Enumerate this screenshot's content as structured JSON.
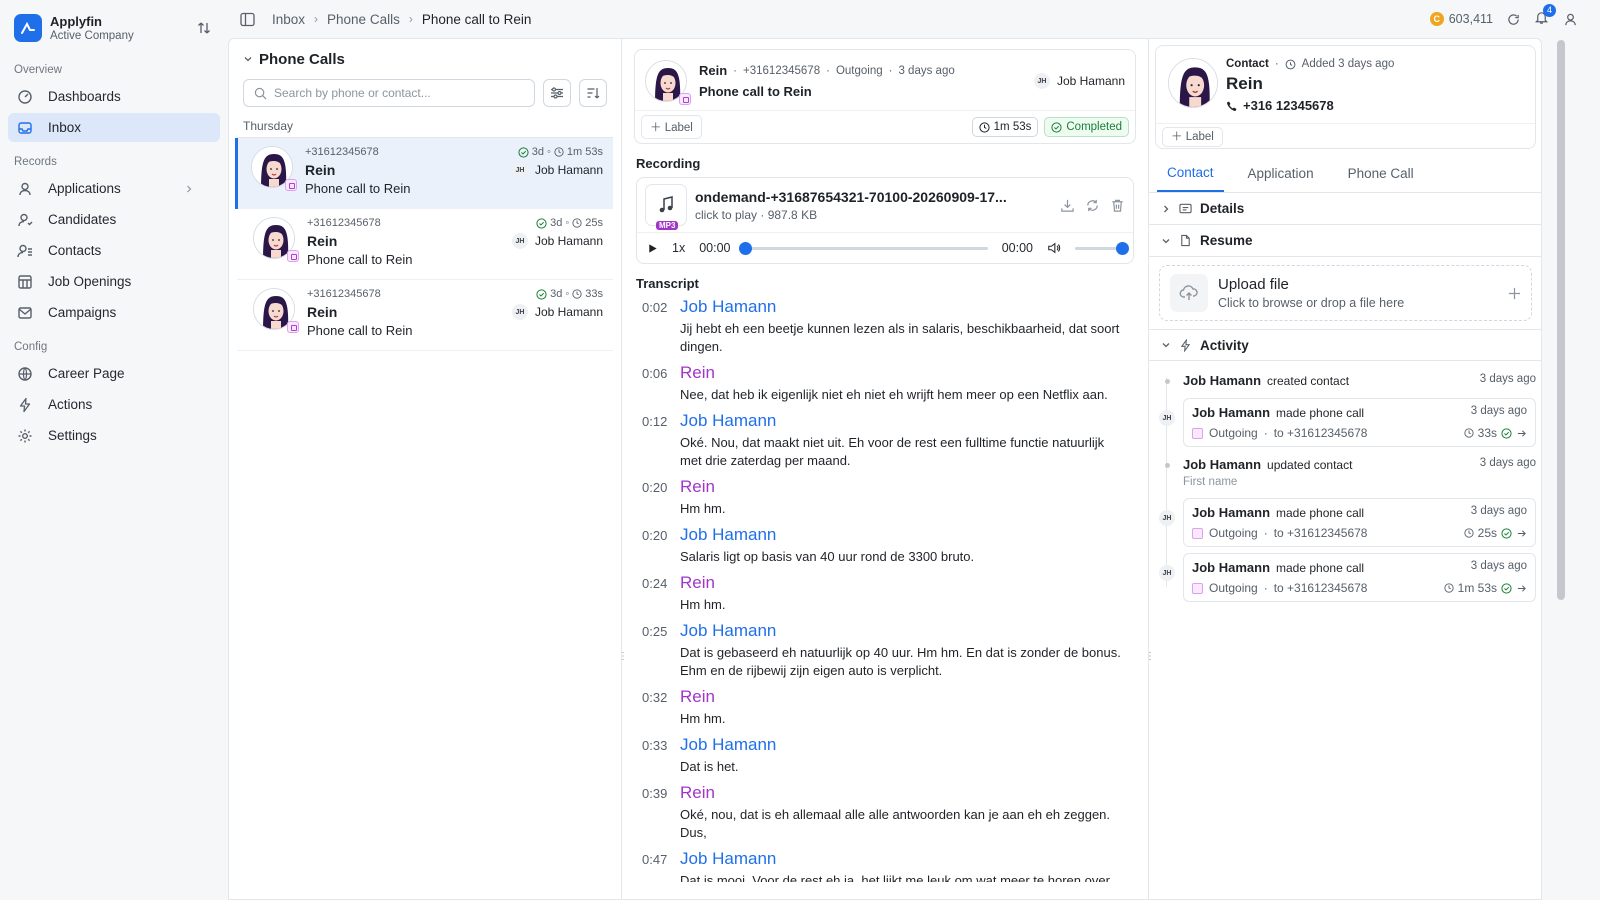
{
  "app": {
    "name": "Applyfin",
    "company": "Active Company"
  },
  "sidebar": {
    "sections": [
      {
        "title": "Overview",
        "items": [
          {
            "label": "Dashboards",
            "icon": "dashboard-icon"
          },
          {
            "label": "Inbox",
            "icon": "inbox-icon",
            "active": true
          }
        ]
      },
      {
        "title": "Records",
        "items": [
          {
            "label": "Applications",
            "icon": "applications-icon"
          },
          {
            "label": "Candidates",
            "icon": "candidates-icon"
          },
          {
            "label": "Contacts",
            "icon": "contacts-icon"
          },
          {
            "label": "Job Openings",
            "icon": "job-openings-icon"
          },
          {
            "label": "Campaigns",
            "icon": "campaigns-icon"
          }
        ]
      },
      {
        "title": "Config",
        "items": [
          {
            "label": "Career Page",
            "icon": "globe-icon"
          },
          {
            "label": "Actions",
            "icon": "bolt-icon"
          },
          {
            "label": "Settings",
            "icon": "gear-icon"
          }
        ]
      }
    ]
  },
  "topbar": {
    "breadcrumbs": [
      "Inbox",
      "Phone Calls",
      "Phone call to Rein"
    ],
    "credits": "603,411",
    "notifications": "4"
  },
  "list": {
    "title": "Phone Calls",
    "search_placeholder": "Search by phone or contact...",
    "group": "Thursday",
    "calls": [
      {
        "phone": "+31612345678",
        "age": "3d",
        "duration": "1m 53s",
        "name": "Rein",
        "subject": "Phone call to Rein",
        "owner_initials": "JH",
        "owner": "Job Hamann"
      },
      {
        "phone": "+31612345678",
        "age": "3d",
        "duration": "25s",
        "name": "Rein",
        "subject": "Phone call to Rein",
        "owner_initials": "JH",
        "owner": "Job Hamann"
      },
      {
        "phone": "+31612345678",
        "age": "3d",
        "duration": "33s",
        "name": "Rein",
        "subject": "Phone call to Rein",
        "owner_initials": "JH",
        "owner": "Job Hamann"
      }
    ]
  },
  "call": {
    "contact": "Rein",
    "phone": "+31612345678",
    "direction": "Outgoing",
    "when": "3 days ago",
    "title": "Phone call to Rein",
    "owner_initials": "JH",
    "owner": "Job Hamann",
    "label_btn": "Label",
    "duration": "1m 53s",
    "status": "Completed"
  },
  "recording": {
    "heading": "Recording",
    "file_name": "ondemand-+31687654321-70100-20260909-17...",
    "hint": "click to play",
    "size": "987.8 KB",
    "format": "MP3",
    "speed": "1x",
    "current": "00:00",
    "total": "00:00"
  },
  "transcript": {
    "heading": "Transcript",
    "entries": [
      {
        "time": "0:02",
        "speaker": "Job Hamann",
        "role": "job",
        "text": "Jij hebt eh een beetje kunnen lezen als in salaris, beschikbaarheid, dat soort dingen."
      },
      {
        "time": "0:06",
        "speaker": "Rein",
        "role": "rein",
        "text": "Nee, dat heb ik eigenlijk niet eh niet eh wrijft hem meer op een Netflix aan."
      },
      {
        "time": "0:12",
        "speaker": "Job Hamann",
        "role": "job",
        "text": "Oké. Nou, dat maakt niet uit. Eh voor de rest een fulltime functie natuurlijk met drie zaterdag per maand."
      },
      {
        "time": "0:20",
        "speaker": "Rein",
        "role": "rein",
        "text": "Hm hm."
      },
      {
        "time": "0:20",
        "speaker": "Job Hamann",
        "role": "job",
        "text": "Salaris ligt op basis van 40 uur rond de 3300 bruto."
      },
      {
        "time": "0:24",
        "speaker": "Rein",
        "role": "rein",
        "text": "Hm hm."
      },
      {
        "time": "0:25",
        "speaker": "Job Hamann",
        "role": "job",
        "text": "Dat is gebaseerd eh natuurlijk op 40 uur. Hm hm. En dat is zonder de bonus. Ehm en de rijbewij zijn eigen auto is verplicht."
      },
      {
        "time": "0:32",
        "speaker": "Rein",
        "role": "rein",
        "text": "Hm hm."
      },
      {
        "time": "0:33",
        "speaker": "Job Hamann",
        "role": "job",
        "text": "Dat is het."
      },
      {
        "time": "0:39",
        "speaker": "Rein",
        "role": "rein",
        "text": "Oké, nou, dat is eh allemaal alle alle antwoorden kan je aan eh eh zeggen. Dus,"
      },
      {
        "time": "0:47",
        "speaker": "Job Hamann",
        "role": "job",
        "text": "Dat is mooi. Voor de rest eh ja, het lijkt me leuk om wat meer te horen over"
      }
    ]
  },
  "contact": {
    "kind": "Contact",
    "added": "Added 3 days ago",
    "name": "Rein",
    "phone": "+316 12345678",
    "label_btn": "Label",
    "tabs": [
      "Contact",
      "Application",
      "Phone Call"
    ],
    "sections": {
      "details": "Details",
      "resume": "Resume",
      "activity": "Activity"
    },
    "upload": {
      "title": "Upload file",
      "subtitle": "Click to browse or drop a file here"
    },
    "activity": [
      {
        "type": "simple",
        "who": "Job Hamann",
        "action": "created contact",
        "when": "3 days ago"
      },
      {
        "type": "call",
        "who": "Job Hamann",
        "action": "made phone call",
        "when": "3 days ago",
        "direction": "Outgoing",
        "to": "to +31612345678",
        "duration": "33s",
        "initials": "JH"
      },
      {
        "type": "simple",
        "who": "Job Hamann",
        "action": "updated contact",
        "when": "3 days ago",
        "sub": "First name"
      },
      {
        "type": "call",
        "who": "Job Hamann",
        "action": "made phone call",
        "when": "3 days ago",
        "direction": "Outgoing",
        "to": "to +31612345678",
        "duration": "25s",
        "initials": "JH"
      },
      {
        "type": "call",
        "who": "Job Hamann",
        "action": "made phone call",
        "when": "3 days ago",
        "direction": "Outgoing",
        "to": "to +31612345678",
        "duration": "1m 53s",
        "initials": "JH"
      }
    ]
  },
  "colors": {
    "accent": "#1f6feb",
    "speaker_rein": "#a035c9",
    "success": "#1a7f37"
  }
}
